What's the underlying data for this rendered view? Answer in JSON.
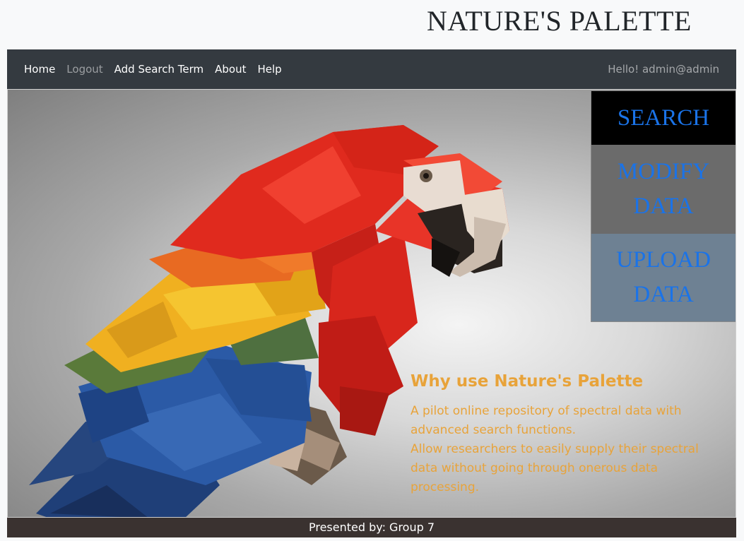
{
  "header": {
    "title": "NATURE'S PALETTE"
  },
  "nav": {
    "links": [
      {
        "label": "Home",
        "muted": false
      },
      {
        "label": "Logout",
        "muted": true
      },
      {
        "label": "Add Search Term",
        "muted": false
      },
      {
        "label": "About",
        "muted": false
      },
      {
        "label": "Help",
        "muted": false
      }
    ],
    "greeting": "Hello! admin@admin"
  },
  "hero": {
    "image": "low-poly-scarlet-macaw-parrot",
    "menu": {
      "search": "SEARCH",
      "modify_line1": "MODIFY",
      "modify_line2": "DATA",
      "upload_line1": "UPLOAD",
      "upload_line2": "DATA"
    },
    "why": {
      "heading": "Why use Nature's Palette",
      "line1": "A pilot online repository of spectral data with advanced search functions.",
      "line2": "Allow researchers to easily supply their spectral data without going through onerous data processing."
    }
  },
  "footer": {
    "text": "Presented by: Group 7"
  },
  "colors": {
    "navbar_bg": "#343a40",
    "menu_link": "#1a73e8",
    "search_bg": "#000000",
    "modify_bg": "#6b6b6b",
    "upload_bg": "#6e8193",
    "why_text": "#e8a33a",
    "footer_bg": "#3a3230"
  }
}
